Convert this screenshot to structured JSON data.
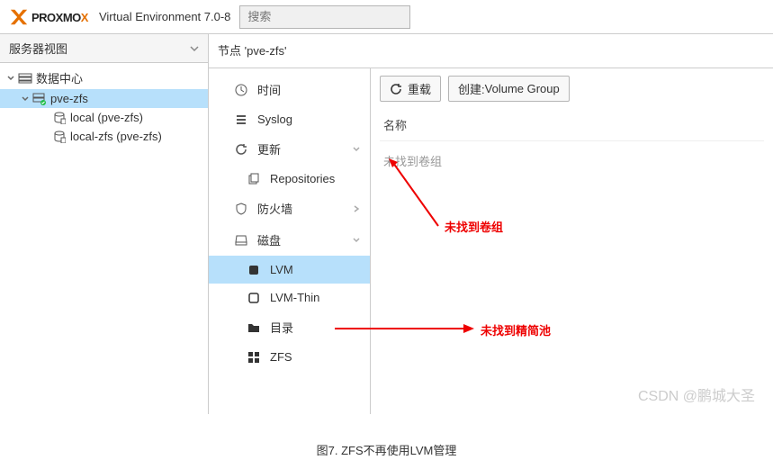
{
  "header": {
    "brand_main": "PROXMO",
    "brand_accent": "X",
    "env": "Virtual Environment 7.0-8",
    "search_placeholder": "搜索"
  },
  "sidebar": {
    "view_label": "服务器视图",
    "tree": {
      "root": "数据中心",
      "node": "pve-zfs",
      "storages": [
        "local (pve-zfs)",
        "local-zfs (pve-zfs)"
      ]
    }
  },
  "main": {
    "crumb": "节点 'pve-zfs'",
    "menu": {
      "time": "时间",
      "syslog": "Syslog",
      "updates": "更新",
      "repositories": "Repositories",
      "firewall": "防火墙",
      "disks": "磁盘",
      "lvm": "LVM",
      "lvmthin": "LVM-Thin",
      "directory": "目录",
      "zfs": "ZFS"
    },
    "toolbar": {
      "reload": "重载",
      "create_prefix": "创建: ",
      "create_item": "Volume Group"
    },
    "table": {
      "col_name": "名称",
      "empty": "未找到卷组"
    }
  },
  "annotations": {
    "a1": "未找到卷组",
    "a2": "未找到精简池"
  },
  "watermark": "CSDN @鹏城大圣",
  "caption": "图7. ZFS不再使用LVM管理"
}
